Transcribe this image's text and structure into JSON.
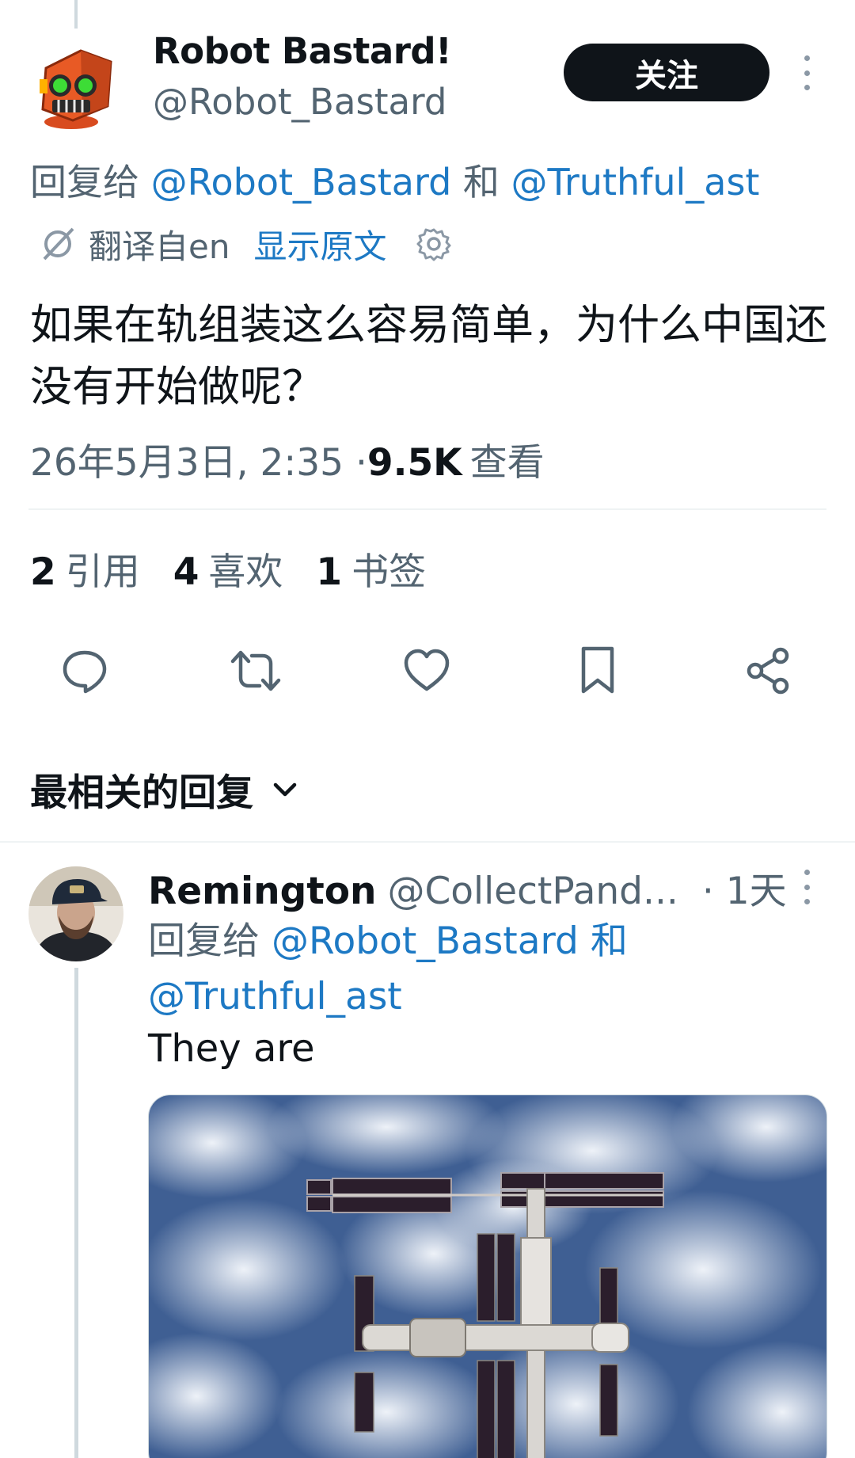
{
  "tweet": {
    "author_name": "Robot Bastard!",
    "author_handle": "@Robot_Bastard",
    "follow_label": "关注",
    "reply_prefix": "回复给 ",
    "reply_mention_1": "@Robot_Bastard",
    "reply_joiner": " 和 ",
    "reply_mention_2": "@Truthful_ast",
    "translated_from": "翻译自en",
    "show_original": "显示原文",
    "text": "如果在轨组装这么容易简单，为什么中国还没有开始做呢？",
    "datetime": "26年5月3日, 2:35 · ",
    "views_count": "9.5K",
    "views_label": "查看",
    "stats": {
      "quotes_count": "2",
      "quotes_label": "引用",
      "likes_count": "4",
      "likes_label": "喜欢",
      "bookmarks_count": "1",
      "bookmarks_label": "书签"
    },
    "actions": [
      "reply-icon",
      "retweet-icon",
      "like-icon",
      "bookmark-icon",
      "share-icon"
    ]
  },
  "replies_sort": {
    "label": "最相关的回复"
  },
  "reply": {
    "author_name": "Remington",
    "author_handle": "@CollectPand...",
    "time": "· 1天",
    "reply_prefix": "回复给 ",
    "reply_mention_1": "@Robot_Bastard",
    "reply_joiner": " 和",
    "reply_mention_2": "@Truthful_ast",
    "text": "They are",
    "media_icon": "space-station-photo"
  },
  "colors": {
    "link": "#1d79c4",
    "muted": "#536471",
    "text": "#0f1419",
    "follow_bg": "#0f1419"
  }
}
